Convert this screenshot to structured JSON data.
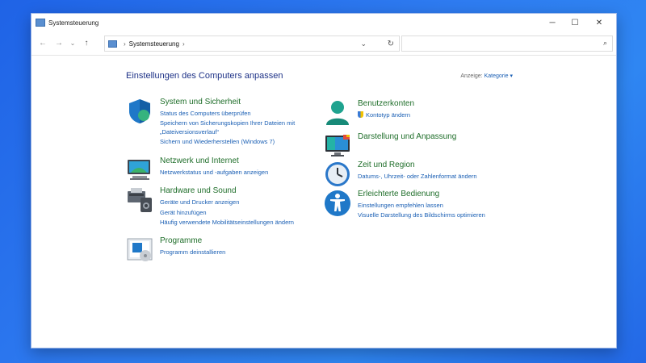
{
  "window": {
    "title": "Systemsteuerung",
    "controls": {
      "minimize": "─",
      "maximize": "☐",
      "close": "✕"
    }
  },
  "toolbar": {
    "back": "←",
    "forward": "→",
    "recent": "⌄",
    "up": "↑",
    "address": {
      "path": [
        "Systemsteuerung"
      ],
      "sep": "›",
      "dropdown": "⌄",
      "refresh": "↻"
    },
    "search": {
      "placeholder": "",
      "icon": "⌕"
    }
  },
  "main": {
    "heading": "Einstellungen des Computers anpassen",
    "view_by_label": "Anzeige:",
    "view_by_value": "Kategorie ▾"
  },
  "left_categories": [
    {
      "title": "System und Sicherheit",
      "icon": "shield-icon",
      "links": [
        "Status des Computers überprüfen",
        "Speichern von Sicherungskopien Ihrer Dateien mit",
        "„Dateiversionsverlauf“",
        "Sichern und Wiederherstellen (Windows 7)"
      ]
    },
    {
      "title": "Netzwerk und Internet",
      "icon": "network-icon",
      "links": [
        "Netzwerkstatus und -aufgaben anzeigen"
      ]
    },
    {
      "title": "Hardware und Sound",
      "icon": "printer-speaker-icon",
      "links": [
        "Geräte und Drucker anzeigen",
        "Gerät hinzufügen",
        "Häufig verwendete Mobilitätseinstellungen ändern"
      ]
    },
    {
      "title": "Programme",
      "icon": "programs-icon",
      "links": [
        "Programm deinstallieren"
      ]
    }
  ],
  "right_categories": [
    {
      "title": "Benutzerkonten",
      "icon": "user-icon",
      "links": [
        "Kontotyp ändern"
      ]
    },
    {
      "title": "Darstellung und Anpassung",
      "icon": "display-icon",
      "links": []
    },
    {
      "title": "Zeit und Region",
      "icon": "clock-globe-icon",
      "links": [
        "Datums-, Uhrzeit- oder Zahlenformat ändern"
      ]
    },
    {
      "title": "Erleichterte Bedienung",
      "icon": "accessibility-icon",
      "links": [
        "Einstellungen empfehlen lassen",
        "Visuelle Darstellung des Bildschirms optimieren"
      ]
    }
  ],
  "colors": {
    "category_title": "#1f6e2a",
    "link": "#1a5fb4",
    "heading": "#1e3287",
    "desktop": "#2a72ec"
  }
}
